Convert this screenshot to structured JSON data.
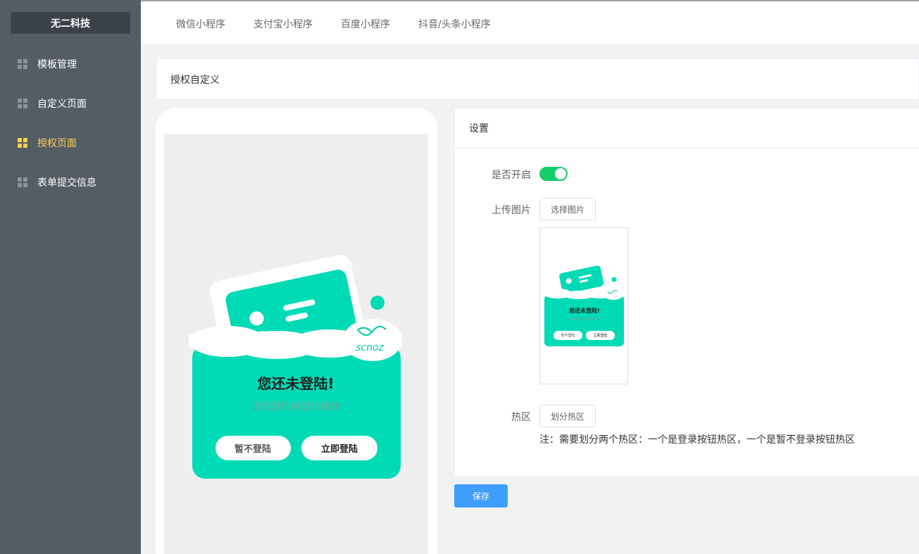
{
  "sidebar": {
    "brand": "无二科技",
    "items": [
      {
        "label": "模板管理"
      },
      {
        "label": "自定义页面"
      },
      {
        "label": "授权页面"
      },
      {
        "label": "表单提交信息"
      }
    ]
  },
  "tabs": [
    "微信小程序",
    "支付宝小程序",
    "百度小程序",
    "抖音/头条小程序"
  ],
  "page_title": "授权自定义",
  "preview": {
    "heading": "您还未登陆!",
    "subtext": "请先登陆再进行操作",
    "btn_skip": "暂不登陆",
    "btn_login": "立即登陆",
    "logo_text": "scnoz"
  },
  "settings": {
    "title": "设置",
    "enable_label": "是否开启",
    "enable_on": true,
    "upload_label": "上传图片",
    "upload_button": "选择图片",
    "hotzone_label": "热区",
    "hotzone_button": "划分热区",
    "note": "注：需要划分两个热区：一个是登录按钮热区，一个是暂不登录按钮热区"
  },
  "save_button": "保存",
  "colors": {
    "sidebar_bg": "#545c64",
    "active": "#ffd04b",
    "teal": "#00dbb6",
    "toggle_on": "#13ce66",
    "primary": "#409eff"
  }
}
